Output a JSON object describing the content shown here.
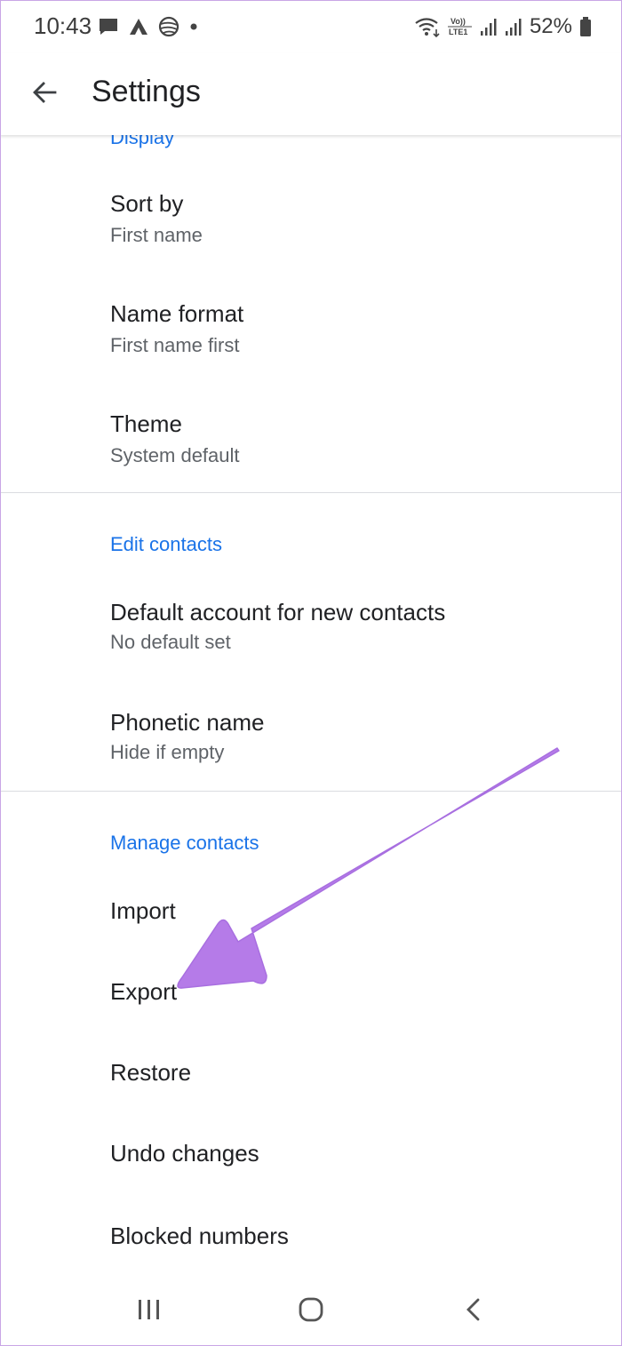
{
  "status_bar": {
    "time": "10:43",
    "battery": "52%",
    "left_icons": [
      "message-icon",
      "app-icon",
      "globe-icon",
      "dot-icon"
    ],
    "right_icons": [
      "wifi-icon",
      "volte-icon",
      "signal-icon",
      "signal-icon",
      "battery-icon"
    ]
  },
  "app_bar": {
    "title": "Settings",
    "back_icon": "arrow-back-icon"
  },
  "sections": {
    "display": {
      "header": "Display",
      "items": [
        {
          "title": "Sort by",
          "subtitle": "First name"
        },
        {
          "title": "Name format",
          "subtitle": "First name first"
        },
        {
          "title": "Theme",
          "subtitle": "System default"
        }
      ]
    },
    "edit_contacts": {
      "header": "Edit contacts",
      "items": [
        {
          "title": "Default account for new contacts",
          "subtitle": "No default set"
        },
        {
          "title": "Phonetic name",
          "subtitle": "Hide if empty"
        }
      ]
    },
    "manage_contacts": {
      "header": "Manage contacts",
      "items": [
        {
          "title": "Import"
        },
        {
          "title": "Export"
        },
        {
          "title": "Restore"
        },
        {
          "title": "Undo changes"
        },
        {
          "title": "Blocked numbers"
        }
      ]
    }
  },
  "nav_bar": {
    "recents_icon": "recents-icon",
    "home_icon": "home-icon",
    "back_icon": "nav-back-icon"
  },
  "colors": {
    "accent": "#1a73e8",
    "annotation_arrow": "#b57be8"
  }
}
